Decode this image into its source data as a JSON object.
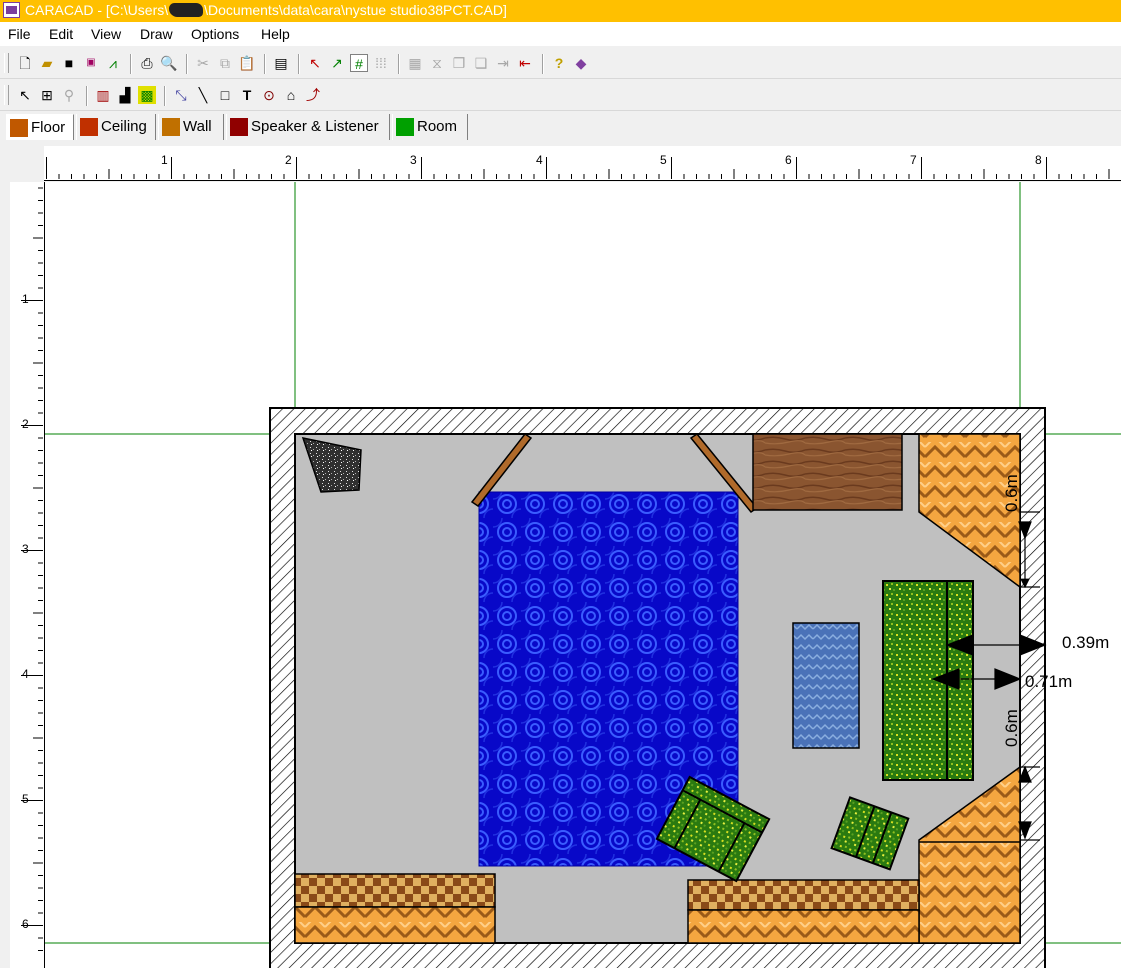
{
  "window": {
    "title": "CARACAD - [C:\\Users\\",
    "title_rest": "\\Documents\\data\\cara\\nystue studio38PCT.CAD]"
  },
  "menu": [
    "File",
    "Edit",
    "View",
    "Draw",
    "Options",
    "Help"
  ],
  "toolbar1": [
    "new-icon",
    "open-icon",
    "save-icon",
    "vga-icon",
    "graph-icon",
    "print-icon",
    "print-preview-icon",
    "cut-icon",
    "copy-icon",
    "paste-icon",
    "properties-icon",
    "arrow-tool-icon",
    "curve-tool-icon",
    "grid-icon",
    "dot-grid-icon",
    "panel-icon",
    "split-icon",
    "layer-icon",
    "layers-icon",
    "import-icon",
    "export-icon",
    "help-icon",
    "book-icon"
  ],
  "toolbar2": [
    "pointer-icon",
    "select-box-icon",
    "zoom-icon",
    "wall-icon",
    "floor-icon",
    "texture-icon",
    "node-icon",
    "line-icon",
    "rectangle-icon",
    "text-icon",
    "circle-icon",
    "polygon-icon",
    "arc-icon"
  ],
  "tabs": [
    {
      "label": "Floor",
      "active": true,
      "color": "#c05800"
    },
    {
      "label": "Ceiling",
      "active": false,
      "color": "#c03000"
    },
    {
      "label": "Wall",
      "active": false,
      "color": "#c07000"
    },
    {
      "label": "Speaker & Listener",
      "active": false,
      "color": "#900000"
    },
    {
      "label": "Room",
      "active": false,
      "color": "#00a000"
    }
  ],
  "ruler": {
    "h_labels": [
      "1",
      "2",
      "3",
      "4",
      "5",
      "6",
      "7",
      "8"
    ],
    "v_labels": [
      "1",
      "2",
      "3",
      "4",
      "5",
      "6"
    ]
  },
  "dimensions": {
    "top_gap": "0.6m",
    "bottom_gap": "0.6m",
    "sofa_wall_front": "0.39m",
    "sofa_wall_back": "0.71m"
  },
  "colors": {
    "titlebar": "#ffc000",
    "floor": "#c0c0c0",
    "rug": "#0808c8",
    "sofa": "#3a8a10",
    "wood": "#8a5530",
    "diffuser": "#d08a30",
    "guides": "#008000"
  }
}
